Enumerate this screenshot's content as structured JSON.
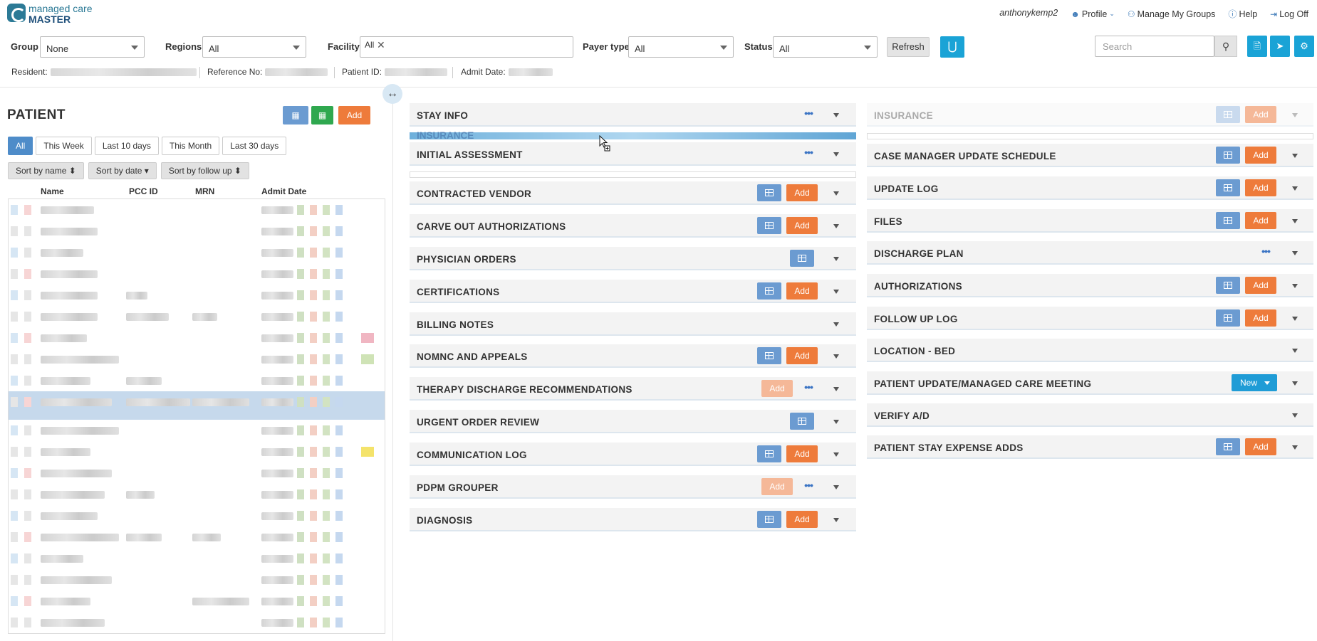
{
  "app": {
    "logo_line1": "managed care",
    "logo_line2": "MASTER",
    "user": "anthonykemp2",
    "nav": {
      "profile": "Profile",
      "groups": "Manage My Groups",
      "help": "Help",
      "logoff": "Log Off"
    }
  },
  "filters": {
    "group_label": "Group",
    "group_value": "None",
    "regions_label": "Regions",
    "regions_value": "All",
    "facility_label": "Facility",
    "facility_chip": "All",
    "payer_label": "Payer type",
    "payer_value": "All",
    "status_label": "Status",
    "status_value": "All",
    "refresh": "Refresh",
    "search_placeholder": "Search"
  },
  "resident_info": {
    "resident_label": "Resident:",
    "reference_label": "Reference No:",
    "patient_id_label": "Patient ID:",
    "admit_label": "Admit Date:"
  },
  "patient_panel": {
    "title": "PATIENT",
    "add": "Add",
    "ranges": [
      "All",
      "This Week",
      "Last 10 days",
      "This Month",
      "Last 30 days"
    ],
    "sorts": [
      "Sort by name ⬍",
      "Sort by date ▾",
      "Sort by follow up ⬍"
    ],
    "columns": [
      "Name",
      "PCC ID",
      "MRN",
      "Admit Date"
    ]
  },
  "sections_middle": {
    "stay_info": "STAY INFO",
    "insurance_ghost": "INSURANCE",
    "initial_assessment": "INITIAL ASSESSMENT",
    "contracted_vendor": "CONTRACTED VENDOR",
    "carve_out": "CARVE OUT AUTHORIZATIONS",
    "physician_orders": "PHYSICIAN ORDERS",
    "certifications": "CERTIFICATIONS",
    "billing_notes": "BILLING NOTES",
    "nomnc": "NOMNC AND APPEALS",
    "therapy_discharge": "THERAPY DISCHARGE RECOMMENDATIONS",
    "urgent_order": "URGENT ORDER REVIEW",
    "communication_log": "COMMUNICATION LOG",
    "pdpm": "PDPM GROUPER",
    "diagnosis": "DIAGNOSIS"
  },
  "sections_right": {
    "insurance": "INSURANCE",
    "case_manager": "CASE MANAGER UPDATE SCHEDULE",
    "update_log": "UPDATE LOG",
    "files": "FILES",
    "discharge_plan": "DISCHARGE PLAN",
    "authorizations": "AUTHORIZATIONS",
    "follow_up_log": "FOLLOW UP LOG",
    "location_bed": "LOCATION - BED",
    "patient_update": "PATIENT UPDATE/MANAGED CARE MEETING",
    "verify_ad": "VERIFY A/D",
    "stay_expense": "PATIENT STAY EXPENSE ADDS"
  },
  "buttons": {
    "add": "Add",
    "new": "New",
    "dots": "•••"
  },
  "colors": {
    "accent_blue": "#1aa3d6",
    "grid_blue": "#6b9bd1",
    "add_orange": "#ee7b3b",
    "new_blue": "#1f9cd6"
  }
}
